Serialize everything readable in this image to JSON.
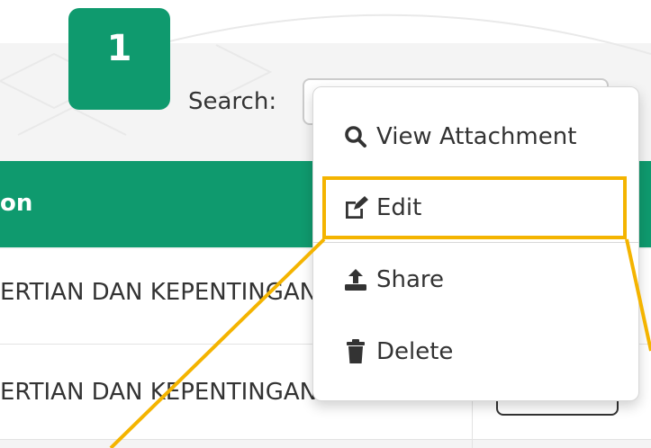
{
  "step_number": "1",
  "search": {
    "label": "Search:"
  },
  "table": {
    "header_partial": "on",
    "rows": [
      {
        "title": "ERTIAN DAN KEPENTINGAN"
      },
      {
        "title": "ERTIAN DAN KEPENTINGAN"
      }
    ]
  },
  "menu": {
    "items": [
      {
        "label": "View Attachment",
        "icon": "search-icon"
      },
      {
        "label": "Edit",
        "icon": "edit-icon"
      },
      {
        "label": "Share",
        "icon": "upload-icon"
      },
      {
        "label": "Delete",
        "icon": "trash-icon"
      }
    ]
  },
  "colors": {
    "accent_green": "#0f9a6e",
    "highlight_yellow": "#f4b400"
  }
}
